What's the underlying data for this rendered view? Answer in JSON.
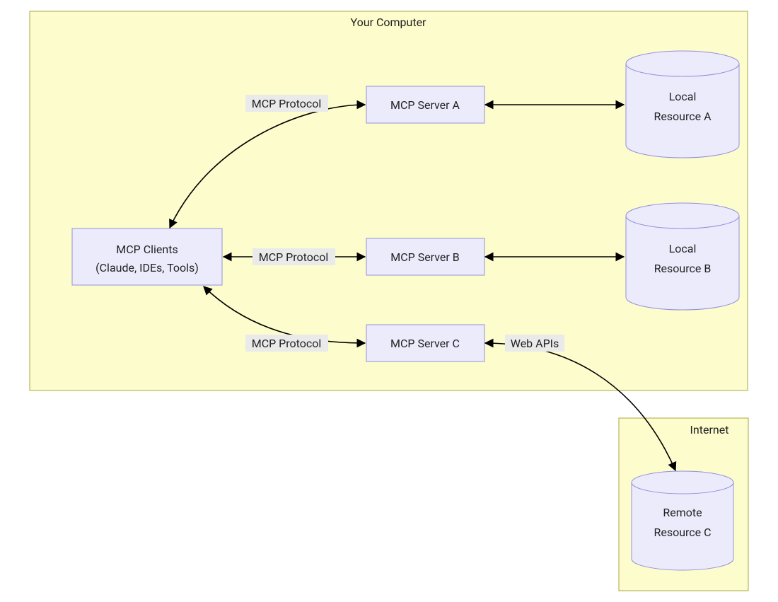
{
  "containers": {
    "computer": {
      "title": "Your Computer"
    },
    "internet": {
      "title": "Internet"
    }
  },
  "nodes": {
    "clients": {
      "line1": "MCP Clients",
      "line2": "(Claude, IDEs, Tools)"
    },
    "serverA": {
      "label": "MCP Server A"
    },
    "serverB": {
      "label": "MCP Server B"
    },
    "serverC": {
      "label": "MCP Server C"
    },
    "resourceA": {
      "line1": "Local",
      "line2": "Resource A"
    },
    "resourceB": {
      "line1": "Local",
      "line2": "Resource B"
    },
    "resourceC": {
      "line1": "Remote",
      "line2": "Resource C"
    }
  },
  "edges": {
    "protoA": "MCP Protocol",
    "protoB": "MCP Protocol",
    "protoC": "MCP Protocol",
    "webapis": "Web APIs"
  }
}
